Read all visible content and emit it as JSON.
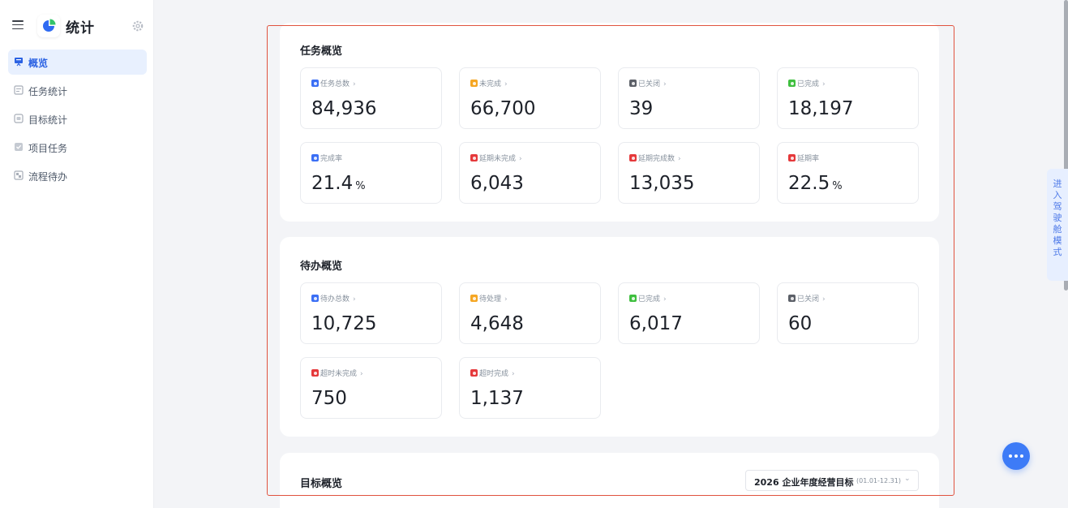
{
  "app": {
    "title": "统计"
  },
  "sidebar": {
    "items": [
      {
        "label": "概览",
        "active": true
      },
      {
        "label": "任务统计"
      },
      {
        "label": "目标统计"
      },
      {
        "label": "项目任务"
      },
      {
        "label": "流程待办"
      }
    ]
  },
  "task_overview": {
    "title": "任务概览",
    "stats": [
      {
        "label": "任务总数",
        "value": "84,936",
        "color": "#3b6ff5",
        "arrow": true
      },
      {
        "label": "未完成",
        "value": "66,700",
        "color": "#f5a623",
        "arrow": true
      },
      {
        "label": "已关闭",
        "value": "39",
        "color": "#5c6068",
        "arrow": true
      },
      {
        "label": "已完成",
        "value": "18,197",
        "color": "#3fbf3f",
        "arrow": true
      },
      {
        "label": "完成率",
        "value": "21.4",
        "unit": "%",
        "color": "#3b6ff5",
        "arrow": false
      },
      {
        "label": "延期未完成",
        "value": "6,043",
        "color": "#e5393b",
        "arrow": true
      },
      {
        "label": "延期完成数",
        "value": "13,035",
        "color": "#e5393b",
        "arrow": true
      },
      {
        "label": "延期率",
        "value": "22.5",
        "unit": "%",
        "color": "#e5393b",
        "arrow": false
      }
    ]
  },
  "todo_overview": {
    "title": "待办概览",
    "stats": [
      {
        "label": "待办总数",
        "value": "10,725",
        "color": "#3b6ff5",
        "arrow": true
      },
      {
        "label": "待处理",
        "value": "4,648",
        "color": "#f5a623",
        "arrow": true
      },
      {
        "label": "已完成",
        "value": "6,017",
        "color": "#3fbf3f",
        "arrow": true
      },
      {
        "label": "已关闭",
        "value": "60",
        "color": "#5c6068",
        "arrow": true
      },
      {
        "label": "超时未完成",
        "value": "750",
        "color": "#e5393b",
        "arrow": true
      },
      {
        "label": "超时完成",
        "value": "1,137",
        "color": "#e5393b",
        "arrow": true
      }
    ]
  },
  "goal_overview": {
    "title": "目标概览",
    "select": {
      "value": "2026 企业年度经营目标",
      "range": "(01.01-12.31)"
    }
  },
  "cockpit_tab": {
    "label": "进入驾驶舱模式"
  },
  "arrow_glyph": "›",
  "chevron_glyph": "⌄",
  "accent": "#2b62e3"
}
